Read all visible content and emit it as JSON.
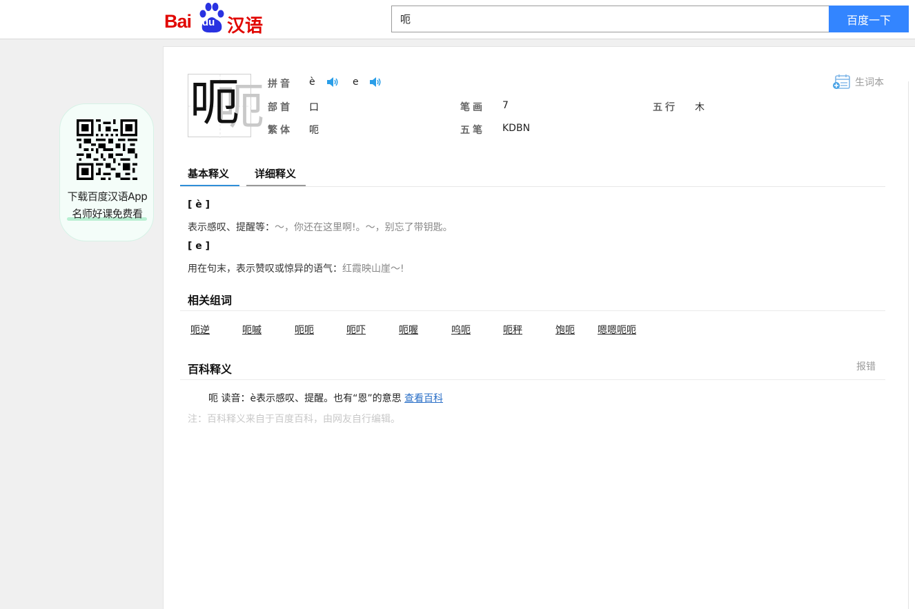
{
  "header": {
    "logo_bai": "Bai",
    "logo_du": "du",
    "logo_hanyu": "汉语",
    "search_value": "呃",
    "search_button": "百度一下"
  },
  "side": {
    "line1": "下载百度汉语App",
    "line2": "名师好课免费看"
  },
  "entry": {
    "char": "呃",
    "pinyin_label": "拼音",
    "pinyin": [
      "è",
      "e"
    ],
    "radical_label": "部首",
    "radical": "口",
    "strokes_label": "笔画",
    "strokes": "7",
    "wuxing_label": "五行",
    "wuxing": "木",
    "traditional_label": "繁体",
    "traditional": "呃",
    "wubi_label": "五笔",
    "wubi": "KDBN",
    "vocab_label": "生词本"
  },
  "tabs": {
    "basic": "基本释义",
    "detail": "详细释义"
  },
  "definitions": [
    {
      "pron": "[ è ]",
      "text": "表示感叹、提醒等：",
      "example": "～，你还在这里啊!。～，别忘了带钥匙。"
    },
    {
      "pron": "[ e ]",
      "text": "用在句末，表示赞叹或惊异的语气：",
      "example": "红霞映山崖～!"
    }
  ],
  "related": {
    "title": "相关组词",
    "words": [
      "呃逆",
      "呃嘁",
      "呃呃",
      "呃吓",
      "呃喔",
      "呜呃",
      "呃秤",
      "饱呃",
      "嗯嗯呃呃"
    ]
  },
  "baike": {
    "title": "百科释义",
    "report": "报错",
    "text": "呃 读音：è表示感叹、提醒。也有“恩”的意思",
    "link": "查看百科",
    "note": "注：百科释义来自于百度百科，由网友自行编辑。"
  },
  "colors": {
    "brand_red": "#e10601",
    "brand_blue": "#2932e1",
    "search_button": "#3385ff",
    "tab_active": "#2f8ed8",
    "speaker": "#2a9ee8"
  }
}
